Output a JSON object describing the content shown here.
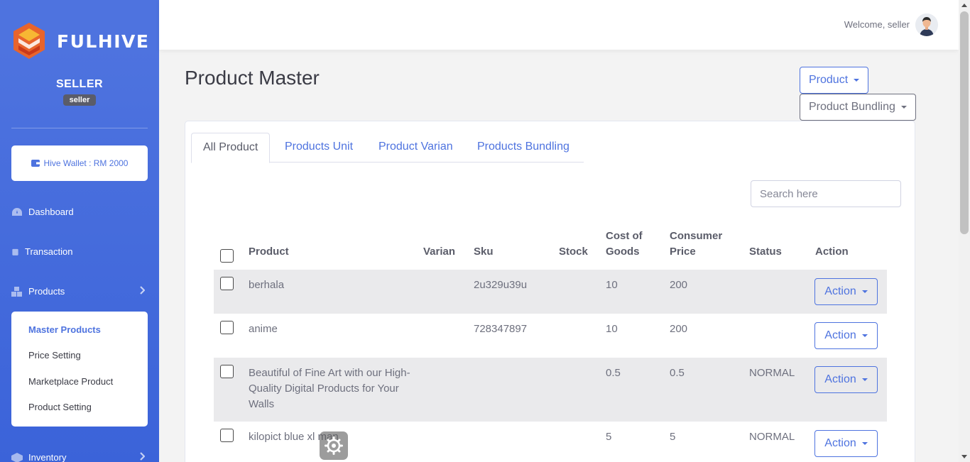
{
  "brand": {
    "name": "FULHIVE"
  },
  "seller": {
    "name": "SELLER",
    "badge": "seller"
  },
  "wallet": {
    "label": "Hive Wallet : RM 2000"
  },
  "nav": {
    "dashboard": "Dashboard",
    "transaction": "Transaction",
    "products": "Products",
    "inventory": "Inventory"
  },
  "submenu": {
    "master_products": "Master Products",
    "price_setting": "Price Setting",
    "marketplace_product": "Marketplace Product",
    "product_setting": "Product Setting"
  },
  "topbar": {
    "welcome": "Welcome, seller"
  },
  "page": {
    "title": "Product Master",
    "product_button": "Product",
    "bundling_button": "Product Bundling"
  },
  "tabs": [
    "All Product",
    "Products Unit",
    "Product Varian",
    "Products Bundling"
  ],
  "search": {
    "placeholder": "Search here"
  },
  "table": {
    "headers": {
      "product": "Product",
      "varian": "Varian",
      "sku": "Sku",
      "stock": "Stock",
      "cost_line1": "Cost of",
      "cost_line2": "Goods",
      "price_line1": "Consumer",
      "price_line2": "Price",
      "status": "Status",
      "action": "Action"
    },
    "rows": [
      {
        "product": "berhala",
        "varian": "",
        "sku": "2u329u39u",
        "stock": "",
        "cost": "10",
        "price": "200",
        "status": "",
        "action": "Action"
      },
      {
        "product": "anime",
        "varian": "",
        "sku": "728347897",
        "stock": "",
        "cost": "10",
        "price": "200",
        "status": "",
        "action": "Action"
      },
      {
        "product": "Beautiful of Fine Art with our High-Quality Digital Products for Your Walls",
        "varian": "",
        "sku": "",
        "stock": "",
        "cost": "0.5",
        "price": "0.5",
        "status": "NORMAL",
        "action": "Action"
      },
      {
        "product": "kilopict blue xl man",
        "varian": "",
        "sku": "",
        "stock": "",
        "cost": "5",
        "price": "5",
        "status": "NORMAL",
        "action": "Action"
      }
    ]
  },
  "colors": {
    "primary": "#4e73df",
    "sidebar": "#4e73df",
    "brand_orange": "#f26b3a"
  }
}
